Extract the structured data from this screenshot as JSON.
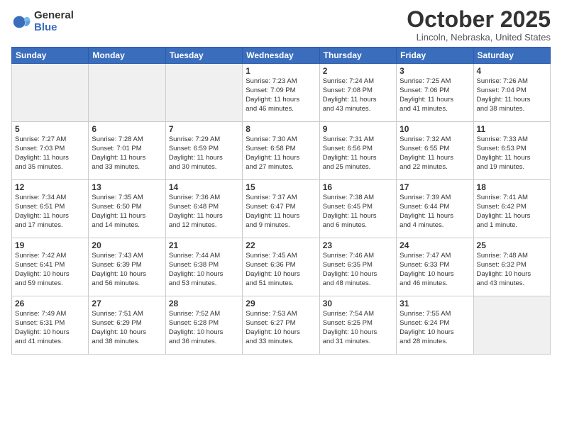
{
  "logo": {
    "general": "General",
    "blue": "Blue"
  },
  "title": "October 2025",
  "location": "Lincoln, Nebraska, United States",
  "days_of_week": [
    "Sunday",
    "Monday",
    "Tuesday",
    "Wednesday",
    "Thursday",
    "Friday",
    "Saturday"
  ],
  "weeks": [
    [
      {
        "day": "",
        "info": "",
        "gray": true
      },
      {
        "day": "",
        "info": "",
        "gray": true
      },
      {
        "day": "",
        "info": "",
        "gray": true
      },
      {
        "day": "1",
        "info": "Sunrise: 7:23 AM\nSunset: 7:09 PM\nDaylight: 11 hours\nand 46 minutes."
      },
      {
        "day": "2",
        "info": "Sunrise: 7:24 AM\nSunset: 7:08 PM\nDaylight: 11 hours\nand 43 minutes."
      },
      {
        "day": "3",
        "info": "Sunrise: 7:25 AM\nSunset: 7:06 PM\nDaylight: 11 hours\nand 41 minutes."
      },
      {
        "day": "4",
        "info": "Sunrise: 7:26 AM\nSunset: 7:04 PM\nDaylight: 11 hours\nand 38 minutes."
      }
    ],
    [
      {
        "day": "5",
        "info": "Sunrise: 7:27 AM\nSunset: 7:03 PM\nDaylight: 11 hours\nand 35 minutes."
      },
      {
        "day": "6",
        "info": "Sunrise: 7:28 AM\nSunset: 7:01 PM\nDaylight: 11 hours\nand 33 minutes."
      },
      {
        "day": "7",
        "info": "Sunrise: 7:29 AM\nSunset: 6:59 PM\nDaylight: 11 hours\nand 30 minutes."
      },
      {
        "day": "8",
        "info": "Sunrise: 7:30 AM\nSunset: 6:58 PM\nDaylight: 11 hours\nand 27 minutes."
      },
      {
        "day": "9",
        "info": "Sunrise: 7:31 AM\nSunset: 6:56 PM\nDaylight: 11 hours\nand 25 minutes."
      },
      {
        "day": "10",
        "info": "Sunrise: 7:32 AM\nSunset: 6:55 PM\nDaylight: 11 hours\nand 22 minutes."
      },
      {
        "day": "11",
        "info": "Sunrise: 7:33 AM\nSunset: 6:53 PM\nDaylight: 11 hours\nand 19 minutes."
      }
    ],
    [
      {
        "day": "12",
        "info": "Sunrise: 7:34 AM\nSunset: 6:51 PM\nDaylight: 11 hours\nand 17 minutes."
      },
      {
        "day": "13",
        "info": "Sunrise: 7:35 AM\nSunset: 6:50 PM\nDaylight: 11 hours\nand 14 minutes."
      },
      {
        "day": "14",
        "info": "Sunrise: 7:36 AM\nSunset: 6:48 PM\nDaylight: 11 hours\nand 12 minutes."
      },
      {
        "day": "15",
        "info": "Sunrise: 7:37 AM\nSunset: 6:47 PM\nDaylight: 11 hours\nand 9 minutes."
      },
      {
        "day": "16",
        "info": "Sunrise: 7:38 AM\nSunset: 6:45 PM\nDaylight: 11 hours\nand 6 minutes."
      },
      {
        "day": "17",
        "info": "Sunrise: 7:39 AM\nSunset: 6:44 PM\nDaylight: 11 hours\nand 4 minutes."
      },
      {
        "day": "18",
        "info": "Sunrise: 7:41 AM\nSunset: 6:42 PM\nDaylight: 11 hours\nand 1 minute."
      }
    ],
    [
      {
        "day": "19",
        "info": "Sunrise: 7:42 AM\nSunset: 6:41 PM\nDaylight: 10 hours\nand 59 minutes."
      },
      {
        "day": "20",
        "info": "Sunrise: 7:43 AM\nSunset: 6:39 PM\nDaylight: 10 hours\nand 56 minutes."
      },
      {
        "day": "21",
        "info": "Sunrise: 7:44 AM\nSunset: 6:38 PM\nDaylight: 10 hours\nand 53 minutes."
      },
      {
        "day": "22",
        "info": "Sunrise: 7:45 AM\nSunset: 6:36 PM\nDaylight: 10 hours\nand 51 minutes."
      },
      {
        "day": "23",
        "info": "Sunrise: 7:46 AM\nSunset: 6:35 PM\nDaylight: 10 hours\nand 48 minutes."
      },
      {
        "day": "24",
        "info": "Sunrise: 7:47 AM\nSunset: 6:33 PM\nDaylight: 10 hours\nand 46 minutes."
      },
      {
        "day": "25",
        "info": "Sunrise: 7:48 AM\nSunset: 6:32 PM\nDaylight: 10 hours\nand 43 minutes."
      }
    ],
    [
      {
        "day": "26",
        "info": "Sunrise: 7:49 AM\nSunset: 6:31 PM\nDaylight: 10 hours\nand 41 minutes."
      },
      {
        "day": "27",
        "info": "Sunrise: 7:51 AM\nSunset: 6:29 PM\nDaylight: 10 hours\nand 38 minutes."
      },
      {
        "day": "28",
        "info": "Sunrise: 7:52 AM\nSunset: 6:28 PM\nDaylight: 10 hours\nand 36 minutes."
      },
      {
        "day": "29",
        "info": "Sunrise: 7:53 AM\nSunset: 6:27 PM\nDaylight: 10 hours\nand 33 minutes."
      },
      {
        "day": "30",
        "info": "Sunrise: 7:54 AM\nSunset: 6:25 PM\nDaylight: 10 hours\nand 31 minutes."
      },
      {
        "day": "31",
        "info": "Sunrise: 7:55 AM\nSunset: 6:24 PM\nDaylight: 10 hours\nand 28 minutes."
      },
      {
        "day": "",
        "info": "",
        "gray": true
      }
    ]
  ]
}
